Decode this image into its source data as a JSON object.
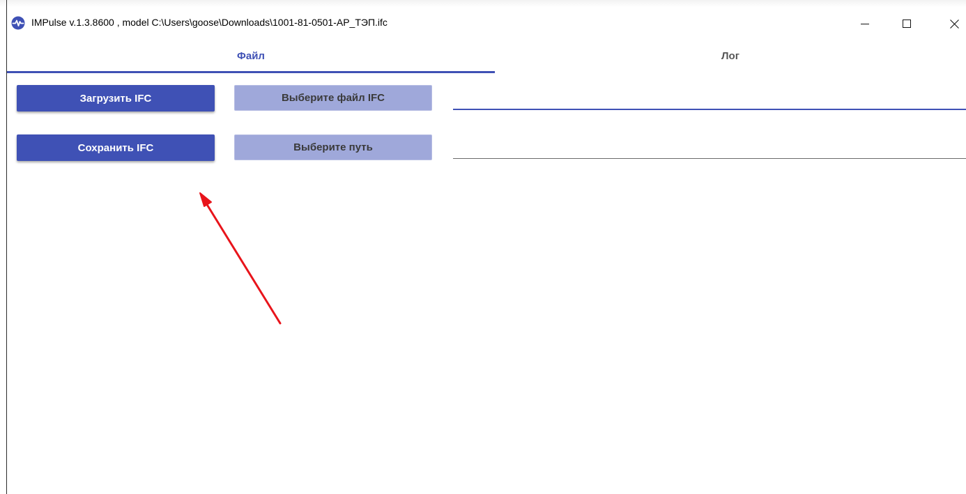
{
  "window": {
    "title": "IMPulse v.1.3.8600 , model C:\\Users\\goose\\Downloads\\1001-81-0501-АР_ТЭП.ifc",
    "controls": {
      "minimize": "—",
      "maximize": "☐",
      "close": "✕"
    }
  },
  "tabs": [
    {
      "label": "Файл",
      "active": true
    },
    {
      "label": "Лог",
      "active": false
    }
  ],
  "file_tab": {
    "load_button": "Загрузить IFC",
    "choose_file_button": "Выберите файл IFC",
    "save_button": "Сохранить IFC",
    "choose_path_button": "Выберите путь",
    "file_path_value": "",
    "save_path_value": ""
  },
  "colors": {
    "accent": "#3f51b5",
    "accent_light": "#9fa8da",
    "annotation_arrow": "#e8141b"
  },
  "icons": {
    "app": "pulse-icon"
  }
}
